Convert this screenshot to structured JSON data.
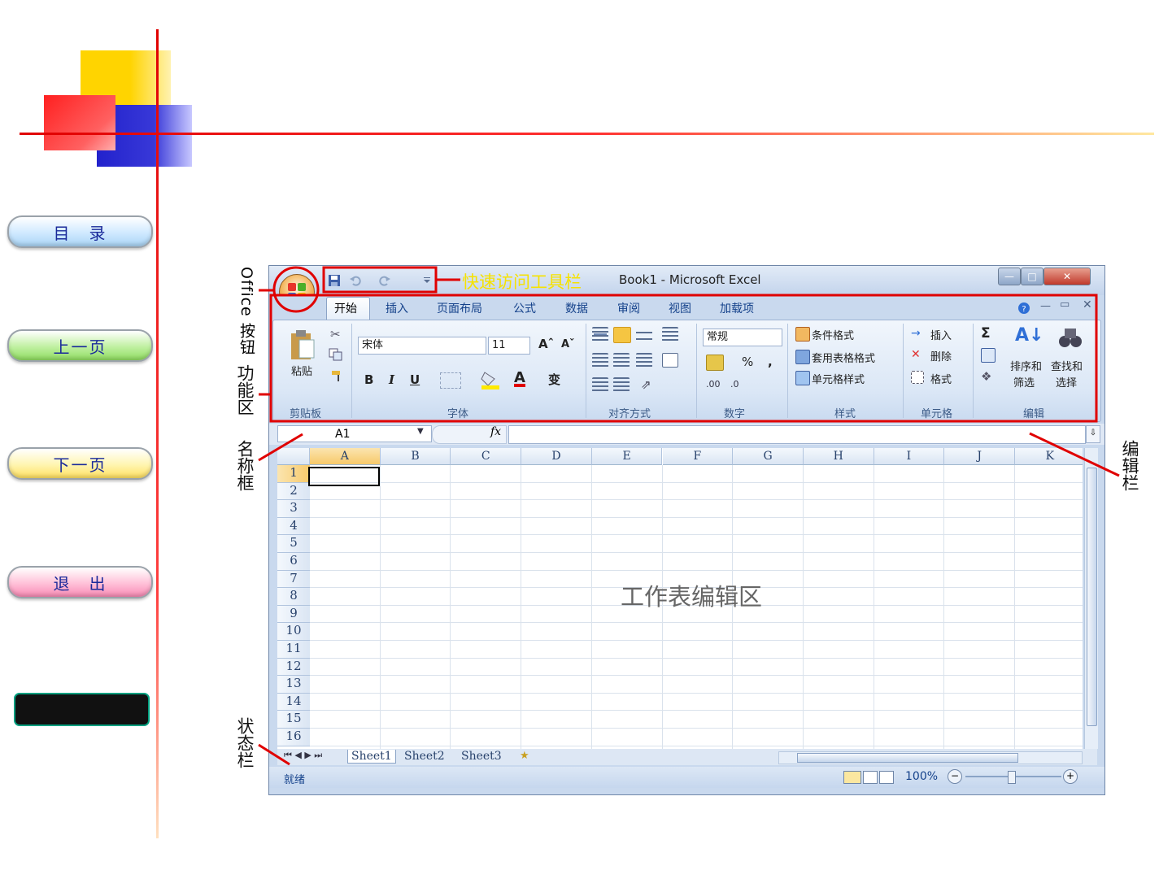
{
  "nav": {
    "toc": "目　录",
    "prev": "上一页",
    "next": "下一页",
    "exit": "退　出"
  },
  "annotations": {
    "office_button": "Office 按钮",
    "ribbon": "功能区",
    "name_box": "名称框",
    "status_bar": "状态栏",
    "edit_bar": "编辑栏",
    "quick_access": "快速访问工具栏",
    "worksheet_area": "工作表编辑区"
  },
  "excel": {
    "title": "Book1 - Microsoft Excel",
    "tabs": [
      "开始",
      "插入",
      "页面布局",
      "公式",
      "数据",
      "审阅",
      "视图",
      "加载项"
    ],
    "clipboard": {
      "paste": "粘贴",
      "label": "剪贴板"
    },
    "font": {
      "name": "宋体",
      "size": "11",
      "label": "字体",
      "bold": "B",
      "italic": "I",
      "underline": "U",
      "grow": "Aˆ",
      "shrink": "Aˇ",
      "color_a": "A",
      "phonetic": "变"
    },
    "alignment": {
      "label": "对齐方式"
    },
    "number": {
      "format": "常规",
      "percent": "%",
      "comma": ",",
      "label": "数字"
    },
    "styles": {
      "conditional": "条件格式",
      "table": "套用表格格式",
      "cell": "单元格样式",
      "label": "样式"
    },
    "cells": {
      "insert": "插入",
      "delete": "删除",
      "format": "格式",
      "label": "单元格"
    },
    "editing": {
      "sigma": "Σ",
      "sort": "排序和",
      "sort2": "筛选",
      "find": "查找和",
      "find2": "选择",
      "label": "编辑"
    },
    "name_box_value": "A1",
    "fx_label": "fx",
    "columns": [
      "A",
      "B",
      "C",
      "D",
      "E",
      "F",
      "G",
      "H",
      "I",
      "J",
      "K"
    ],
    "rows": [
      "1",
      "2",
      "3",
      "4",
      "5",
      "6",
      "7",
      "8",
      "9",
      "10",
      "11",
      "12",
      "13",
      "14",
      "15",
      "16"
    ],
    "sheets": [
      "Sheet1",
      "Sheet2",
      "Sheet3"
    ],
    "status": "就绪",
    "zoom": "100%"
  }
}
